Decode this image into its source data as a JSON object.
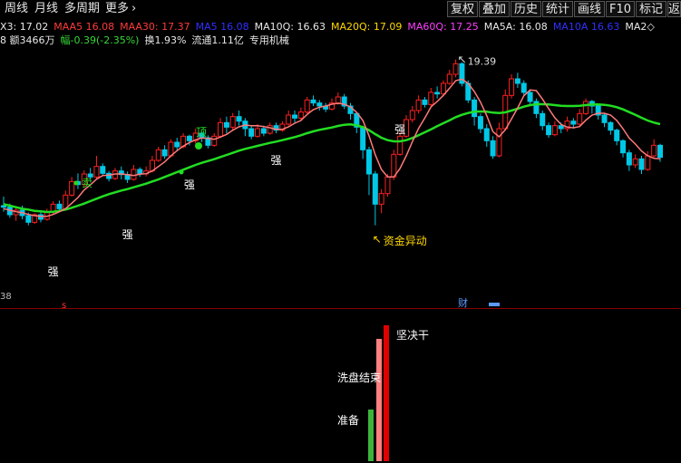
{
  "toolbar": {
    "left_items": [
      "周线",
      "月线",
      "多周期",
      "更多"
    ],
    "more_arrow": "›",
    "right_buttons": [
      "复权",
      "叠加",
      "历史",
      "统计",
      "画线",
      "F10",
      "标记",
      "返回"
    ]
  },
  "ma_line": [
    {
      "text": "X3: 17.02",
      "color": "#e8e8e8"
    },
    {
      "text": "MAA5  16.08",
      "color": "#ff3b3b"
    },
    {
      "text": "MAA30: 17.37",
      "color": "#ff3b3b"
    },
    {
      "text": "MA5  16.08",
      "color": "#3030ff"
    },
    {
      "text": "MA10Q: 16.63",
      "color": "#e8e8e8"
    },
    {
      "text": "MA20Q: 17.09",
      "color": "#ffd700"
    },
    {
      "text": "MA60Q: 17.25",
      "color": "#ff40ff"
    },
    {
      "text": "MA5A: 16.08",
      "color": "#e8e8e8"
    },
    {
      "text": "MA10A  16.63",
      "color": "#3030ff"
    },
    {
      "text": "MA2◇",
      "color": "#e8e8e8"
    }
  ],
  "info_line": [
    {
      "text": "8 额3466万",
      "color": "#e8e8e8"
    },
    {
      "text": "幅-0.39(-2.35%)",
      "color": "#38d838"
    },
    {
      "text": "换1.93%",
      "color": "#e8e8e8"
    },
    {
      "text": "流通1.11亿",
      "color": "#e8e8e8"
    },
    {
      "text": "专用机械",
      "color": "#e8e8e8"
    }
  ],
  "annotations": {
    "high_label": "19.39",
    "high_arrow": "↖",
    "fund_label": "资金异动",
    "fund_arrow": "↖",
    "strong": "强",
    "sell": "卖",
    "top": "顶",
    "low_axis_label": "38",
    "finance_marker": "财",
    "s_marker": "s"
  },
  "sub_panel": {
    "label_prepare": "准备",
    "label_washout": "洗盘结束",
    "label_decisive": "坚决干"
  },
  "colors": {
    "up": "#ff2020",
    "down": "#00c8e6",
    "ma_fast": "#ff7a7a",
    "ma_slow": "#22dd22",
    "bar_green": "#3cb43c",
    "bar_pink": "#ff8080",
    "bar_red": "#e00000"
  },
  "chart_data": {
    "type": "candlestick",
    "y_scale_top": 19.8,
    "y_scale_bottom": 12.3,
    "high_marker_value": 19.39,
    "candles": [
      [
        14.55,
        14.5,
        14.85,
        14.35
      ],
      [
        14.5,
        14.25,
        14.62,
        14.15
      ],
      [
        14.25,
        14.4,
        14.5,
        14.05
      ],
      [
        14.4,
        14.22,
        14.55,
        14.1
      ],
      [
        14.22,
        14.0,
        14.32,
        13.9
      ],
      [
        14.0,
        14.25,
        14.3,
        13.95
      ],
      [
        14.25,
        14.1,
        14.4,
        14.0
      ],
      [
        14.1,
        14.35,
        14.45,
        14.05
      ],
      [
        14.35,
        14.6,
        14.7,
        14.25
      ],
      [
        14.6,
        14.45,
        14.72,
        14.38
      ],
      [
        14.45,
        14.9,
        15.05,
        14.4
      ],
      [
        14.9,
        15.35,
        15.5,
        14.85
      ],
      [
        15.35,
        15.25,
        15.62,
        15.1
      ],
      [
        15.25,
        15.6,
        15.72,
        15.15
      ],
      [
        15.6,
        15.5,
        15.8,
        15.4
      ],
      [
        15.5,
        15.85,
        16.2,
        15.45
      ],
      [
        15.85,
        15.62,
        15.95,
        15.55
      ],
      [
        15.62,
        15.45,
        15.7,
        15.35
      ],
      [
        15.45,
        15.7,
        15.8,
        15.4
      ],
      [
        15.7,
        15.58,
        15.85,
        15.42
      ],
      [
        15.58,
        15.42,
        15.68,
        15.3
      ],
      [
        15.42,
        15.75,
        15.9,
        15.38
      ],
      [
        15.75,
        15.6,
        15.82,
        15.5
      ],
      [
        15.6,
        15.7,
        15.85,
        15.52
      ],
      [
        15.7,
        16.05,
        16.2,
        15.65
      ],
      [
        16.05,
        16.4,
        16.5,
        16.0
      ],
      [
        16.4,
        16.2,
        16.55,
        16.1
      ],
      [
        16.2,
        16.65,
        16.75,
        16.15
      ],
      [
        16.65,
        16.5,
        16.8,
        16.35
      ],
      [
        16.5,
        16.85,
        16.95,
        16.45
      ],
      [
        16.85,
        16.7,
        16.9,
        16.55
      ],
      [
        16.7,
        16.95,
        17.1,
        16.6
      ],
      [
        16.95,
        16.8,
        17.0,
        16.65
      ],
      [
        16.8,
        16.55,
        16.88,
        16.45
      ],
      [
        16.55,
        16.85,
        16.95,
        16.5
      ],
      [
        16.85,
        17.3,
        17.45,
        16.8
      ],
      [
        17.3,
        17.15,
        17.5,
        16.95
      ],
      [
        17.15,
        17.5,
        17.62,
        17.05
      ],
      [
        17.5,
        17.35,
        17.7,
        17.2
      ],
      [
        17.35,
        17.1,
        17.45,
        16.85
      ],
      [
        17.1,
        16.85,
        17.2,
        16.75
      ],
      [
        16.85,
        17.1,
        17.25,
        16.8
      ],
      [
        17.1,
        16.95,
        17.2,
        16.85
      ],
      [
        16.95,
        17.2,
        17.3,
        16.9
      ],
      [
        17.2,
        17.05,
        17.3,
        16.95
      ],
      [
        17.05,
        17.25,
        17.35,
        17.0
      ],
      [
        17.25,
        17.55,
        17.7,
        17.2
      ],
      [
        17.55,
        17.45,
        17.7,
        17.3
      ],
      [
        17.45,
        17.65,
        17.8,
        17.35
      ],
      [
        17.65,
        18.05,
        18.15,
        17.6
      ],
      [
        18.05,
        17.95,
        18.2,
        17.85
      ],
      [
        17.95,
        17.85,
        18.05,
        17.7
      ],
      [
        17.85,
        17.75,
        17.95,
        17.65
      ],
      [
        17.75,
        17.95,
        18.1,
        17.7
      ],
      [
        17.95,
        18.15,
        18.3,
        17.9
      ],
      [
        18.15,
        17.85,
        18.25,
        17.75
      ],
      [
        17.85,
        17.6,
        17.95,
        17.4
      ],
      [
        17.6,
        17.15,
        17.65,
        16.95
      ],
      [
        17.15,
        16.4,
        17.2,
        16.1
      ],
      [
        16.4,
        15.6,
        16.5,
        14.9
      ],
      [
        15.6,
        14.6,
        15.7,
        13.9
      ],
      [
        14.6,
        14.95,
        15.1,
        14.3
      ],
      [
        14.95,
        15.5,
        15.6,
        14.85
      ],
      [
        15.5,
        16.25,
        16.4,
        15.4
      ],
      [
        16.25,
        16.85,
        17.0,
        16.2
      ],
      [
        16.85,
        17.4,
        17.55,
        16.8
      ],
      [
        17.4,
        17.7,
        17.85,
        17.3
      ],
      [
        17.7,
        18.05,
        18.2,
        17.6
      ],
      [
        18.05,
        17.9,
        18.15,
        17.8
      ],
      [
        17.9,
        18.3,
        18.45,
        17.85
      ],
      [
        18.3,
        18.25,
        18.5,
        18.1
      ],
      [
        18.25,
        18.6,
        18.7,
        18.2
      ],
      [
        18.6,
        18.9,
        19.05,
        18.55
      ],
      [
        18.9,
        19.25,
        19.39,
        18.8
      ],
      [
        19.25,
        18.6,
        19.3,
        18.5
      ],
      [
        18.6,
        18.05,
        18.7,
        17.95
      ],
      [
        18.05,
        17.5,
        18.15,
        17.2
      ],
      [
        17.5,
        17.1,
        17.6,
        16.95
      ],
      [
        17.1,
        16.7,
        17.25,
        16.5
      ],
      [
        16.7,
        16.2,
        16.85,
        16.1
      ],
      [
        16.2,
        17.1,
        17.3,
        16.15
      ],
      [
        17.1,
        18.2,
        18.4,
        17.05
      ],
      [
        18.2,
        18.75,
        18.9,
        18.1
      ],
      [
        18.75,
        18.6,
        18.95,
        18.45
      ],
      [
        18.6,
        18.3,
        18.7,
        18.2
      ],
      [
        18.3,
        18.0,
        18.4,
        17.85
      ],
      [
        18.0,
        17.6,
        18.1,
        17.45
      ],
      [
        17.6,
        17.2,
        17.7,
        17.05
      ],
      [
        17.2,
        16.9,
        17.3,
        16.8
      ],
      [
        16.9,
        17.2,
        17.35,
        16.85
      ],
      [
        17.2,
        17.1,
        17.3,
        16.95
      ],
      [
        17.1,
        17.35,
        17.5,
        17.0
      ],
      [
        17.35,
        17.25,
        17.45,
        17.1
      ],
      [
        17.25,
        17.6,
        17.75,
        17.2
      ],
      [
        17.6,
        18.0,
        18.1,
        17.55
      ],
      [
        18.0,
        17.85,
        18.05,
        17.6
      ],
      [
        17.85,
        17.55,
        17.9,
        17.4
      ],
      [
        17.55,
        17.3,
        17.6,
        17.15
      ],
      [
        17.3,
        17.05,
        17.35,
        16.9
      ],
      [
        17.05,
        16.7,
        17.1,
        16.55
      ],
      [
        16.7,
        16.3,
        16.75,
        16.15
      ],
      [
        16.3,
        15.9,
        16.4,
        15.7
      ],
      [
        15.9,
        16.1,
        16.25,
        15.8
      ],
      [
        16.1,
        15.75,
        16.2,
        15.6
      ],
      [
        15.75,
        16.2,
        16.35,
        15.7
      ],
      [
        16.2,
        16.55,
        16.75,
        16.15
      ],
      [
        16.55,
        16.15,
        16.6,
        16.0
      ]
    ],
    "ma_fast": [
      14.45,
      14.4,
      14.35,
      14.32,
      14.26,
      14.22,
      14.2,
      14.2,
      14.26,
      14.35,
      14.45,
      14.63,
      14.82,
      15.07,
      15.24,
      15.43,
      15.55,
      15.56,
      15.6,
      15.6,
      15.58,
      15.55,
      15.59,
      15.61,
      15.7,
      15.85,
      16.0,
      16.2,
      16.37,
      16.52,
      16.64,
      16.73,
      16.79,
      16.78,
      16.75,
      16.82,
      16.91,
      17.05,
      17.16,
      17.22,
      17.2,
      17.2,
      17.17,
      17.13,
      17.08,
      17.08,
      17.16,
      17.28,
      17.37,
      17.57,
      17.73,
      17.81,
      17.85,
      17.91,
      17.94,
      17.91,
      17.82,
      17.64,
      17.37,
      16.86,
      16.24,
      15.75,
      15.5,
      15.5,
      15.78,
      16.2,
      16.67,
      17.11,
      17.45,
      17.82,
      18.0,
      18.2,
      18.44,
      18.69,
      18.74,
      18.6,
      18.33,
      17.98,
      17.53,
      17.0,
      16.83,
      17.06,
      17.42,
      17.79,
      18.19,
      18.38,
      18.36,
      18.08,
      17.76,
      17.46,
      17.24,
      17.15,
      17.13,
      17.17,
      17.38,
      17.55,
      17.61,
      17.61,
      17.55,
      17.37,
      17.1,
      16.79,
      16.59,
      16.36,
      16.2,
      16.12,
      16.1
    ],
    "ma_slow": [
      14.6,
      14.55,
      14.5,
      14.45,
      14.42,
      14.38,
      14.36,
      14.34,
      14.35,
      14.38,
      14.42,
      14.48,
      14.55,
      14.62,
      14.7,
      14.78,
      14.86,
      14.93,
      14.99,
      15.05,
      15.1,
      15.16,
      15.22,
      15.28,
      15.35,
      15.42,
      15.5,
      15.58,
      15.66,
      15.74,
      15.82,
      15.9,
      15.97,
      16.03,
      16.09,
      16.16,
      16.23,
      16.3,
      16.37,
      16.43,
      16.48,
      16.53,
      16.58,
      16.63,
      16.67,
      16.72,
      16.77,
      16.82,
      16.88,
      16.95,
      17.01,
      17.06,
      17.1,
      17.14,
      17.19,
      17.23,
      17.24,
      17.21,
      17.15,
      17.05,
      16.92,
      16.8,
      16.72,
      16.68,
      16.68,
      16.72,
      16.79,
      16.88,
      16.98,
      17.08,
      17.18,
      17.28,
      17.38,
      17.48,
      17.56,
      17.62,
      17.66,
      17.67,
      17.66,
      17.63,
      17.62,
      17.64,
      17.7,
      17.76,
      17.83,
      17.88,
      17.91,
      17.91,
      17.9,
      17.88,
      17.86,
      17.85,
      17.85,
      17.86,
      17.88,
      17.9,
      17.9,
      17.89,
      17.86,
      17.81,
      17.74,
      17.65,
      17.56,
      17.46,
      17.37,
      17.3,
      17.25
    ],
    "signal_bars": [
      {
        "name": "准备",
        "value": 0.38
      },
      {
        "name": "洗盘结束",
        "value": 0.9
      },
      {
        "name": "坚决干",
        "value": 1.0
      }
    ]
  }
}
